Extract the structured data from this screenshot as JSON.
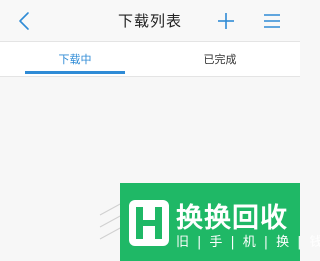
{
  "nav": {
    "title": "下载列表",
    "back_icon": "chevron-left-icon",
    "add_icon": "plus-icon",
    "menu_icon": "hamburger-menu-icon"
  },
  "tabs": [
    {
      "label": "下载中",
      "active": true
    },
    {
      "label": "已完成",
      "active": false
    }
  ],
  "watermark": {
    "title": "换换回收",
    "subtitle": "旧|手|机|换|钱"
  },
  "colors": {
    "accent": "#2f8bd6",
    "watermark_green": "#1fb866",
    "background": "#f7f7f7"
  }
}
